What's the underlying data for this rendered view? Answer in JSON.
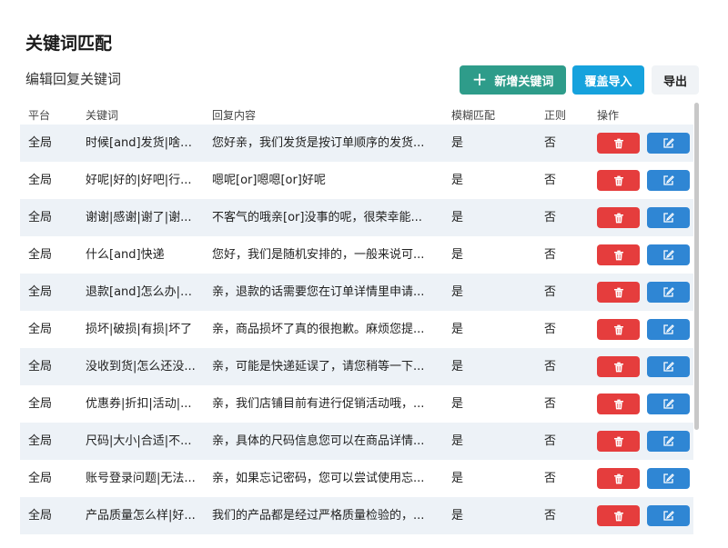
{
  "page": {
    "title": "关键词匹配",
    "subtitle": "编辑回复关键词"
  },
  "toolbar": {
    "add_label": "新增关键词",
    "import_label": "覆盖导入",
    "export_label": "导出"
  },
  "table": {
    "headers": {
      "platform": "平台",
      "keyword": "关键词",
      "reply": "回复内容",
      "fuzzy": "模糊匹配",
      "regex": "正则",
      "actions": "操作"
    },
    "rows": [
      {
        "platform": "全局",
        "keyword": "时候[and]发货|啥时...",
        "reply": "您好亲，我们发货是按订单顺序的发货...",
        "fuzzy": "是",
        "regex": "否"
      },
      {
        "platform": "全局",
        "keyword": "好呢|好的|好吧|行...",
        "reply": "嗯呢[or]嗯嗯[or]好呢",
        "fuzzy": "是",
        "regex": "否"
      },
      {
        "platform": "全局",
        "keyword": "谢谢|感谢|谢了|谢...",
        "reply": "不客气的哦亲[or]没事的呢，很荣幸能...",
        "fuzzy": "是",
        "regex": "否"
      },
      {
        "platform": "全局",
        "keyword": "什么[and]快递",
        "reply": "您好，我们是随机安排的，一般来说可...",
        "fuzzy": "是",
        "regex": "否"
      },
      {
        "platform": "全局",
        "keyword": "退款[and]怎么办|怎...",
        "reply": "亲，退款的话需要您在订单详情里申请...",
        "fuzzy": "是",
        "regex": "否"
      },
      {
        "platform": "全局",
        "keyword": "损坏|破损|有损|坏了",
        "reply": "亲，商品损坏了真的很抱歉。麻烦您提...",
        "fuzzy": "是",
        "regex": "否"
      },
      {
        "platform": "全局",
        "keyword": "没收到货|怎么还没...",
        "reply": "亲，可能是快递延误了，请您稍等一下...",
        "fuzzy": "是",
        "regex": "否"
      },
      {
        "platform": "全局",
        "keyword": "优惠券|折扣|活动|...",
        "reply": "亲，我们店铺目前有进行促销活动哦，...",
        "fuzzy": "是",
        "regex": "否"
      },
      {
        "platform": "全局",
        "keyword": "尺码|大小|合适|不...",
        "reply": "亲，具体的尺码信息您可以在商品详情...",
        "fuzzy": "是",
        "regex": "否"
      },
      {
        "platform": "全局",
        "keyword": "账号登录问题|无法...",
        "reply": "亲，如果忘记密码，您可以尝试使用忘...",
        "fuzzy": "是",
        "regex": "否"
      },
      {
        "platform": "全局",
        "keyword": "产品质量怎么样|好...",
        "reply": "我们的产品都是经过严格质量检验的，...",
        "fuzzy": "是",
        "regex": "否"
      }
    ]
  },
  "icons": {
    "add": "plus-icon",
    "delete": "trash-icon",
    "edit": "edit-icon"
  },
  "colors": {
    "add_button": "#2e9c8a",
    "import_button": "#16a2dd",
    "export_button": "#f0f3f6",
    "delete_button": "#e53d3d",
    "edit_button": "#2f86d4",
    "row_stripe": "#edf2f7"
  }
}
